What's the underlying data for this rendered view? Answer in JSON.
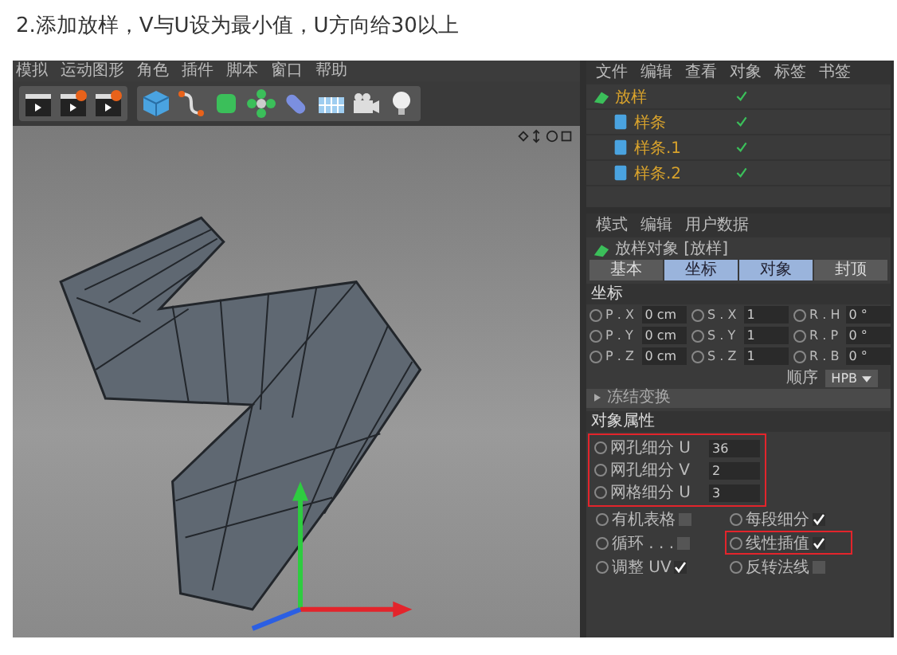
{
  "caption": "2.添加放样，V与U设为最小值，U方向给30以上",
  "menu": [
    "模拟",
    "运动图形",
    "角色",
    "插件",
    "脚本",
    "窗口",
    "帮助"
  ],
  "object_manager": {
    "menu": [
      "文件",
      "编辑",
      "查看",
      "对象",
      "标签",
      "书签"
    ],
    "objects": [
      {
        "name": "放样",
        "enabled": true,
        "children": [
          {
            "name": "样条",
            "enabled": true
          },
          {
            "name": "样条.1",
            "enabled": true
          },
          {
            "name": "样条.2",
            "enabled": true
          }
        ]
      }
    ]
  },
  "attributes": {
    "menu": [
      "模式",
      "编辑",
      "用户数据"
    ],
    "object_title": "放样对象 [放样]",
    "tabs": [
      {
        "label": "基本",
        "selected": false
      },
      {
        "label": "坐标",
        "selected": true
      },
      {
        "label": "对象",
        "selected": true
      },
      {
        "label": "封顶",
        "selected": false
      }
    ],
    "coord_section": "坐标",
    "coords": [
      [
        {
          "label": "P . X",
          "value": "0 cm"
        },
        {
          "label": "S . X",
          "value": "1"
        },
        {
          "label": "R . H",
          "value": "0 °"
        }
      ],
      [
        {
          "label": "P . Y",
          "value": "0 cm"
        },
        {
          "label": "S . Y",
          "value": "1"
        },
        {
          "label": "R . P",
          "value": "0 °"
        }
      ],
      [
        {
          "label": "P . Z",
          "value": "0 cm"
        },
        {
          "label": "S . Z",
          "value": "1"
        },
        {
          "label": "R . B",
          "value": "0 °"
        }
      ]
    ],
    "order_label": "顺序",
    "order_value": "HPB",
    "freeze": "冻结变换",
    "props_section": "对象属性",
    "fields": {
      "highlighted": true,
      "items": [
        {
          "label": "网孔细分 U",
          "value": "36"
        },
        {
          "label": "网孔细分 V",
          "value": "2"
        },
        {
          "label": "网格细分 U",
          "value": "3"
        }
      ]
    },
    "checks": [
      [
        {
          "label": "有机表格",
          "checked": false,
          "highlighted": false
        },
        {
          "label": "每段细分",
          "checked": true,
          "highlighted": false
        }
      ],
      [
        {
          "label": "循环 . . .",
          "checked": false,
          "highlighted": false
        },
        {
          "label": "线性插值",
          "checked": true,
          "highlighted": true
        }
      ],
      [
        {
          "label": "调整 UV",
          "checked": true,
          "highlighted": false
        },
        {
          "label": "反转法线",
          "checked": false,
          "highlighted": false
        }
      ]
    ]
  }
}
